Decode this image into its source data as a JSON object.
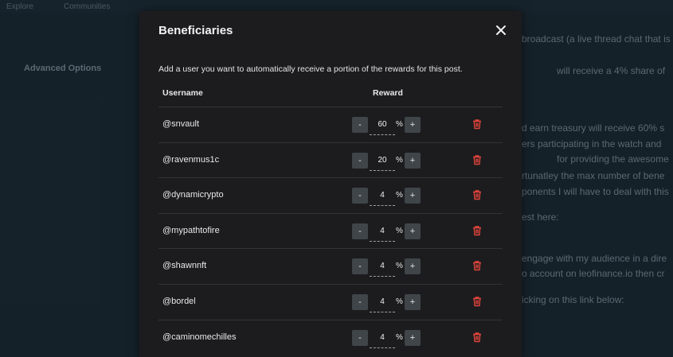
{
  "background": {
    "nav_items": [
      "Explore",
      "Communities"
    ],
    "left_crumb": "...",
    "advanced_options_label": "Advanced Options",
    "advanced_options_sub": "...",
    "right_lines": [
      "broadcast (a live thread chat that is",
      "will receive a 4% share of",
      "d earn treasury will receive 60% s",
      "ers participating in the watch and",
      "for providing the awesome",
      "rtunatley the max number of bene",
      "ponents I will have to deal with this",
      "est here:",
      "engage with my audience in a dire",
      "o account on leofinance.io then cr",
      "icking on this link below:"
    ]
  },
  "modal": {
    "title": "Beneficiaries",
    "description": "Add a user you want to automatically receive a portion of the rewards for this post.",
    "columns": {
      "username": "Username",
      "reward": "Reward"
    },
    "minus_label": "-",
    "plus_label": "+",
    "percent_sign": "%",
    "beneficiaries": [
      {
        "username": "@snvault",
        "reward": "60"
      },
      {
        "username": "@ravenmus1c",
        "reward": "20"
      },
      {
        "username": "@dynamicrypto",
        "reward": "4"
      },
      {
        "username": "@mypathtofire",
        "reward": "4"
      },
      {
        "username": "@shawnnft",
        "reward": "4"
      },
      {
        "username": "@bordel",
        "reward": "4"
      },
      {
        "username": "@caminomechilles",
        "reward": "4"
      }
    ]
  },
  "colors": {
    "modal_bg": "#1c1c1e",
    "stepper_btn": "#3f4549",
    "trash_icon": "#e0443b",
    "page_bg": "#1d2a34"
  }
}
